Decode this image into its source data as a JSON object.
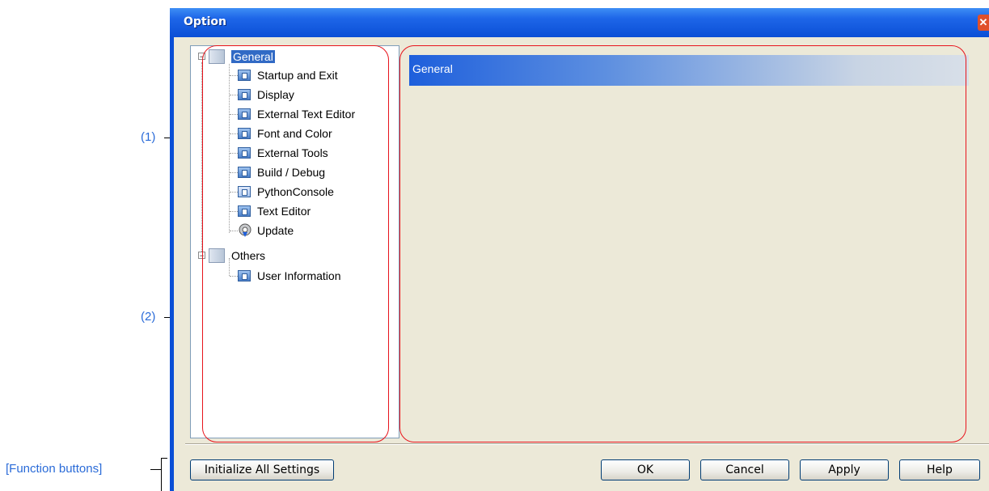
{
  "annotations": {
    "label1": "(1)",
    "label2": "(2)",
    "function_buttons": "[Function buttons]"
  },
  "window": {
    "title": "Option",
    "close_icon": "close-icon"
  },
  "tree": {
    "groups": [
      {
        "label": "General",
        "expanded": true,
        "selected": true,
        "items": [
          {
            "label": "Startup and Exit",
            "icon": "page-icon"
          },
          {
            "label": "Display",
            "icon": "page-icon"
          },
          {
            "label": "External Text Editor",
            "icon": "page-icon"
          },
          {
            "label": "Font and Color",
            "icon": "page-icon"
          },
          {
            "label": "External Tools",
            "icon": "page-icon"
          },
          {
            "label": "Build / Debug",
            "icon": "page-icon"
          },
          {
            "label": "PythonConsole",
            "icon": "python-console-icon"
          },
          {
            "label": "Text Editor",
            "icon": "page-icon"
          },
          {
            "label": "Update",
            "icon": "update-icon"
          }
        ]
      },
      {
        "label": "Others",
        "expanded": true,
        "selected": false,
        "items": [
          {
            "label": "User Information",
            "icon": "page-icon"
          }
        ]
      }
    ]
  },
  "content": {
    "header": "General"
  },
  "buttons": {
    "initialize": "Initialize All Settings",
    "ok": "OK",
    "cancel": "Cancel",
    "apply": "Apply",
    "help": "Help"
  },
  "colors": {
    "title_bar": "#0a4fd6",
    "dialog_bg": "#ece9d8",
    "annotation": "#2a6bd8",
    "highlight_box": "#e8141c",
    "selection": "#316ac5"
  }
}
